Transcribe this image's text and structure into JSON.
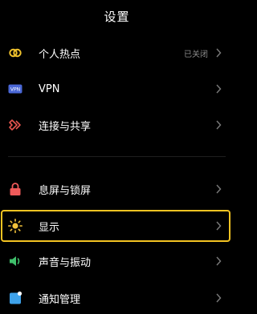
{
  "header": {
    "title": "设置"
  },
  "items": [
    {
      "label": "个人热点",
      "value": "已关闭",
      "icon": "hotspot-icon",
      "color": "#f0c22d"
    },
    {
      "label": "VPN",
      "value": "",
      "icon": "vpn-icon",
      "icon_text": "VPN",
      "color": "#4a67d6"
    },
    {
      "label": "连接与共享",
      "value": "",
      "icon": "connection-share-icon",
      "color": "#e6554f"
    },
    {
      "label": "息屏与锁屏",
      "value": "",
      "icon": "lock-icon",
      "color": "#ef5a5a"
    },
    {
      "label": "显示",
      "value": "",
      "icon": "display-brightness-icon",
      "color": "#f2c23a"
    },
    {
      "label": "声音与振动",
      "value": "",
      "icon": "sound-icon",
      "color": "#3fc06b"
    },
    {
      "label": "通知管理",
      "value": "",
      "icon": "notification-icon",
      "color": "#3ea2ea"
    }
  ],
  "selected_item": "显示"
}
